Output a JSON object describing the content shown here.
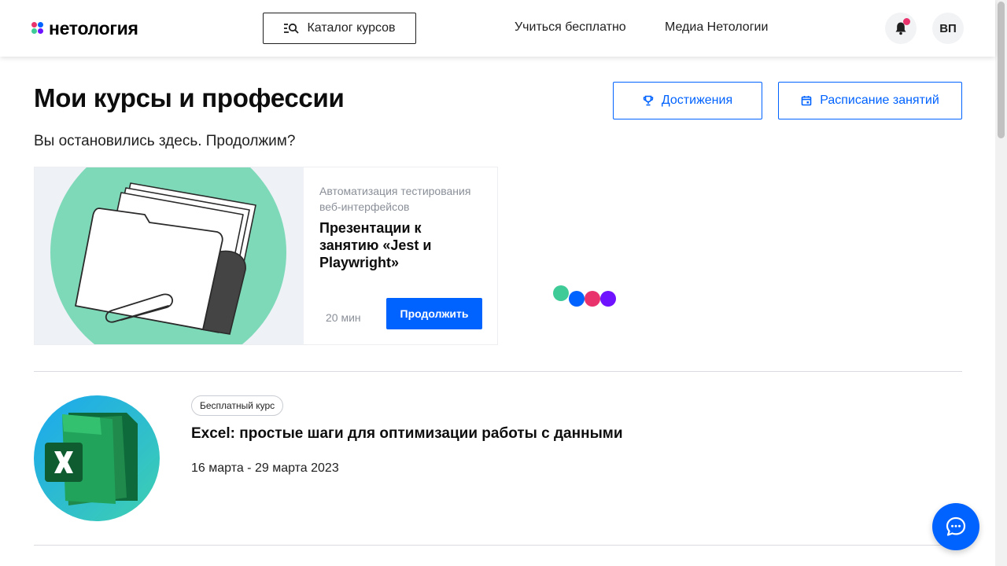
{
  "header": {
    "logo_text": "нетология",
    "catalog_label": "Каталог курсов",
    "nav": [
      {
        "label": "Учиться бесплатно"
      },
      {
        "label": "Медиа Нетологии"
      }
    ],
    "avatar_initials": "ВП"
  },
  "main": {
    "title": "Мои курсы и профессии",
    "achievements_label": "Достижения",
    "schedule_label": "Расписание занятий",
    "resume_text": "Вы остановились здесь. Продолжим?"
  },
  "continue_card": {
    "course_name": "Автоматизация тестирования веб-интерфейсов",
    "lesson_title": "Презентации к занятию «Jest и Playwright»",
    "duration": "20 мин",
    "continue_label": "Продолжить"
  },
  "courses": [
    {
      "badge": "Бесплатный курс",
      "title": "Excel: простые шаги для оптимизации работы с данными",
      "dates": "16 марта - 29 марта 2023"
    }
  ],
  "colors": {
    "accent": "#0062ff",
    "notification_dot": "#e8336d",
    "loader": [
      "#3ecb98",
      "#0062ff",
      "#e8336d",
      "#6e12ff"
    ],
    "logo_dots": [
      "#e8336d",
      "#0062ff",
      "#3ecb98",
      "#6e12ff"
    ],
    "illustration_circle": "#7ed9b8"
  },
  "icons": {
    "catalog": "catalog-search-icon",
    "bell": "bell-icon",
    "trophy": "trophy-icon",
    "calendar": "calendar-icon",
    "chat": "chat-bubble-icon",
    "excel": "excel-logo-icon"
  }
}
